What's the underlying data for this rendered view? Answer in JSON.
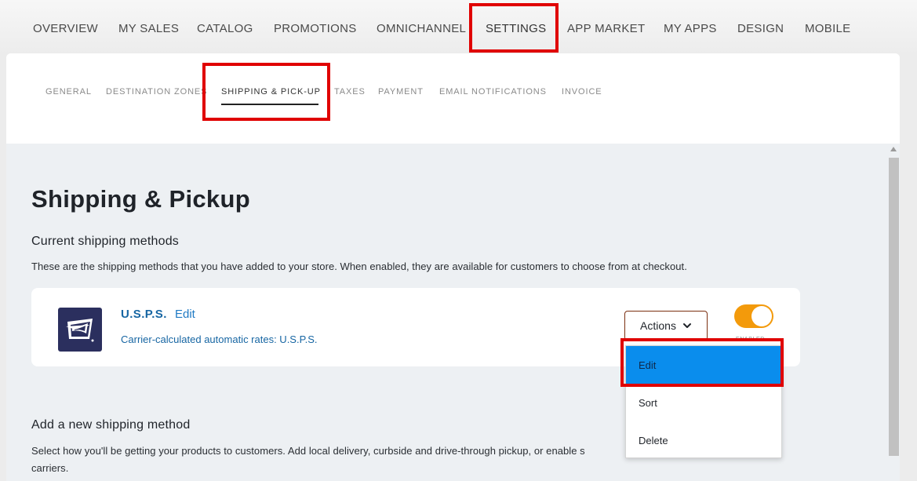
{
  "topnav": {
    "items": [
      "OVERVIEW",
      "MY SALES",
      "CATALOG",
      "PROMOTIONS",
      "OMNICHANNEL",
      "SETTINGS",
      "APP MARKET",
      "MY APPS",
      "DESIGN",
      "MOBILE"
    ],
    "active": "SETTINGS"
  },
  "subnav": {
    "items": [
      "GENERAL",
      "DESTINATION ZONES",
      "SHIPPING & PICK-UP",
      "TAXES",
      "PAYMENT",
      "EMAIL NOTIFICATIONS",
      "INVOICE"
    ],
    "active": "SHIPPING & PICK-UP"
  },
  "page": {
    "title": "Shipping & Pickup",
    "current_title": "Current shipping methods",
    "current_desc": "These are the shipping methods that you have added to your store. When enabled, they are available for customers to choose from at checkout.",
    "add_title": "Add a new shipping method",
    "add_desc_line1": "Select how you'll be getting your products to customers. Add local delivery, curbside and drive-through pickup, or enable s",
    "add_desc_line2": "carriers."
  },
  "method": {
    "name": "U.S.P.S.",
    "edit_label": "Edit",
    "subtitle": "Carrier-calculated automatic rates: U.S.P.S.",
    "actions_label": "Actions",
    "toggle_caption": "ENABLED",
    "enabled": true
  },
  "dropdown": {
    "items": [
      "Edit",
      "Sort",
      "Delete"
    ],
    "selected": "Edit"
  },
  "colors": {
    "highlight": "#e00000",
    "toggle_on": "#f39a0b",
    "link": "#1766a3",
    "dropdown_selected": "#0a8ded"
  }
}
